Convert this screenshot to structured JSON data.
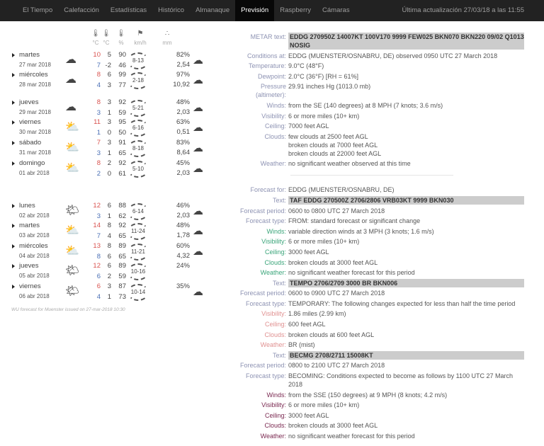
{
  "nav": {
    "tabs": [
      "El Tiempo",
      "Calefacción",
      "Estadísticas",
      "Histórico",
      "Almanaque",
      "Previsión",
      "Raspberry",
      "Cámaras"
    ],
    "active": "Previsión",
    "last_update": "Última actualización 27/03/18 a las 11:55"
  },
  "forecast": {
    "headers": [
      {
        "icon": "thermometer-max-icon",
        "unit": "°C"
      },
      {
        "icon": "thermometer-min-icon",
        "unit": "°C"
      },
      {
        "icon": "humidity-icon",
        "unit": "%"
      },
      {
        "icon": "wind-flag-icon",
        "unit": "km/h"
      },
      {
        "icon": "rain-drops-icon",
        "unit": "mm"
      }
    ],
    "days": [
      {
        "day": "martes",
        "date": "27 mar 2018",
        "icon": "cloudy-icon",
        "tmax": [
          "10",
          "7"
        ],
        "tmin": [
          "5",
          "-2"
        ],
        "hum": [
          "90",
          "46"
        ],
        "wind": "8-13",
        "pop": "82%",
        "rain": "2,54"
      },
      {
        "day": "miércoles",
        "date": "28 mar 2018",
        "icon": "cloudy-icon",
        "tmax": [
          "8",
          "4"
        ],
        "tmin": [
          "6",
          "3"
        ],
        "hum": [
          "99",
          "77"
        ],
        "wind": "2-18",
        "pop": "97%",
        "rain": "10,92"
      },
      {
        "day": "jueves",
        "date": "29 mar 2018",
        "icon": "cloudy-icon",
        "tmax": [
          "8",
          "3"
        ],
        "tmin": [
          "3",
          "1"
        ],
        "hum": [
          "92",
          "59"
        ],
        "wind": "5-21",
        "pop": "48%",
        "rain": "2,03"
      },
      {
        "day": "viernes",
        "date": "30 mar 2018",
        "icon": "partly-cloudy-icon",
        "tmax": [
          "11",
          "1"
        ],
        "tmin": [
          "3",
          "0"
        ],
        "hum": [
          "95",
          "50"
        ],
        "wind": "6-16",
        "pop": "63%",
        "rain": "0,51"
      },
      {
        "day": "sábado",
        "date": "31 mar 2018",
        "icon": "partly-cloudy-icon",
        "tmax": [
          "7",
          "3"
        ],
        "tmin": [
          "3",
          "1"
        ],
        "hum": [
          "91",
          "65"
        ],
        "wind": "8-18",
        "pop": "83%",
        "rain": "8,64"
      },
      {
        "day": "domingo",
        "date": "01 abr 2018",
        "icon": "partly-cloudy-icon",
        "tmax": [
          "8",
          "2"
        ],
        "tmin": [
          "2",
          "0"
        ],
        "hum": [
          "92",
          "61"
        ],
        "wind": "5-10",
        "pop": "45%",
        "rain": "2,03"
      },
      {
        "day": "lunes",
        "date": "02 abr 2018",
        "icon": "mostly-sunny-icon",
        "tmax": [
          "12",
          "3"
        ],
        "tmin": [
          "6",
          "1"
        ],
        "hum": [
          "88",
          "62"
        ],
        "wind": "6-14",
        "pop": "46%",
        "rain": "2,03"
      },
      {
        "day": "martes",
        "date": "03 abr 2018",
        "icon": "partly-cloudy-icon",
        "tmax": [
          "14",
          "7"
        ],
        "tmin": [
          "8",
          "4"
        ],
        "hum": [
          "92",
          "65"
        ],
        "wind": "11-24",
        "pop": "48%",
        "rain": "1,78"
      },
      {
        "day": "miércoles",
        "date": "04 abr 2018",
        "icon": "partly-cloudy-icon",
        "tmax": [
          "13",
          "8"
        ],
        "tmin": [
          "8",
          "6"
        ],
        "hum": [
          "89",
          "65"
        ],
        "wind": "11-21",
        "pop": "60%",
        "rain": "4,32"
      },
      {
        "day": "jueves",
        "date": "05 abr 2018",
        "icon": "mostly-sunny-icon",
        "tmax": [
          "12",
          "6"
        ],
        "tmin": [
          "6",
          "2"
        ],
        "hum": [
          "89",
          "59"
        ],
        "wind": "10-16",
        "pop": "24%",
        "rain": ""
      },
      {
        "day": "viernes",
        "date": "06 abr 2018",
        "icon": "mostly-sunny-icon",
        "tmax": [
          "6",
          "4"
        ],
        "tmin": [
          "3",
          "1"
        ],
        "hum": [
          "87",
          "73"
        ],
        "wind": "10-14",
        "pop": "35%",
        "rain": ""
      }
    ],
    "footer": "WU forecast for Muenster issued on 27-mar-2018 10:30"
  },
  "metar": [
    {
      "label": "METAR text:",
      "value": "EDDG 270950Z 14007KT 100V170 9999 FEW025 BKN070 BKN220 09/02 Q1013 NOSIG",
      "code": true
    },
    {
      "label": "Conditions at:",
      "value": "EDDG (MUENSTER/OSNABRU, DE) observed 0950 UTC 27 March 2018"
    },
    {
      "label": "Temperature:",
      "value": "9.0°C (48°F)"
    },
    {
      "label": "Dewpoint:",
      "value": "2.0°C (36°F) [RH = 61%]"
    },
    {
      "label": "Pressure (altimeter):",
      "value": "29.91 inches Hg (1013.0 mb)"
    },
    {
      "label": "Winds:",
      "value": "from the SE (140 degrees) at 8 MPH (7 knots; 3.6 m/s)"
    },
    {
      "label": "Visibility:",
      "value": "6 or more miles (10+ km)"
    },
    {
      "label": "Ceiling:",
      "value": "7000 feet AGL"
    },
    {
      "label": "Clouds:",
      "value": "few clouds at 2500 feet AGL\nbroken clouds at 7000 feet AGL\nbroken clouds at 22000 feet AGL"
    },
    {
      "label": "Weather:",
      "value": "no significant weather observed at this time"
    }
  ],
  "taf": [
    {
      "label": "Forecast for:",
      "value": "EDDG (MUENSTER/OSNABRU, DE)"
    },
    {
      "label": "Text:",
      "value": "TAF EDDG 270500Z 2706/2806 VRB03KT 9999 BKN030",
      "code": true
    },
    {
      "label": "Forecast period:",
      "value": "0600 to 0800 UTC 27 March 2018"
    },
    {
      "label": "Forecast type:",
      "value": "FROM: standard forecast or significant change"
    },
    {
      "label": "Winds:",
      "value": "variable direction winds at 3 MPH (3 knots; 1.6 m/s)",
      "group": "g"
    },
    {
      "label": "Visibility:",
      "value": "6 or more miles (10+ km)",
      "group": "g"
    },
    {
      "label": "Ceiling:",
      "value": "3000 feet AGL",
      "group": "g"
    },
    {
      "label": "Clouds:",
      "value": "broken clouds at 3000 feet AGL",
      "group": "g"
    },
    {
      "label": "Weather:",
      "value": "no significant weather forecast for this period",
      "group": "g"
    },
    {
      "label": "Text:",
      "value": "TEMPO 2706/2709 3000 BR BKN006",
      "code": true
    },
    {
      "label": "Forecast period:",
      "value": "0600 to 0900 UTC 27 March 2018"
    },
    {
      "label": "Forecast type:",
      "value": "TEMPORARY: The following changes expected for less than half the time period"
    },
    {
      "label": "Visibility:",
      "value": "1.86 miles (2.99 km)",
      "group": "t"
    },
    {
      "label": "Ceiling:",
      "value": "600 feet AGL",
      "group": "t"
    },
    {
      "label": "Clouds:",
      "value": "broken clouds at 600 feet AGL",
      "group": "t"
    },
    {
      "label": "Weather:",
      "value": "BR  (mist)",
      "group": "t"
    },
    {
      "label": "Text:",
      "value": "BECMG 2708/2711 15008KT",
      "code": true
    },
    {
      "label": "Forecast period:",
      "value": "0800 to 2100 UTC 27 March 2018"
    },
    {
      "label": "Forecast type:",
      "value": "BECOMING: Conditions expected to become as follows by 1100 UTC 27 March 2018"
    },
    {
      "label": "Winds:",
      "value": "from the SSE (150 degrees) at 9 MPH (8 knots; 4.2 m/s)",
      "group": "b"
    },
    {
      "label": "Visibility:",
      "value": "6 or more miles (10+ km)",
      "group": "b"
    },
    {
      "label": "Ceiling:",
      "value": "3000 feet AGL",
      "group": "b"
    },
    {
      "label": "Clouds:",
      "value": "broken clouds at 3000 feet AGL",
      "group": "b"
    },
    {
      "label": "Weather:",
      "value": "no significant weather forecast for this period",
      "group": "b"
    }
  ],
  "colors": {
    "nav_bg": "#222222",
    "temp_max": "#d9534f",
    "temp_min": "#4a6fb5",
    "code_bg": "#cccccc",
    "label": "#8e93b3",
    "taf_group": "#3aa57a",
    "tempo_group": "#e09191",
    "becmg_group": "#7a2850"
  }
}
